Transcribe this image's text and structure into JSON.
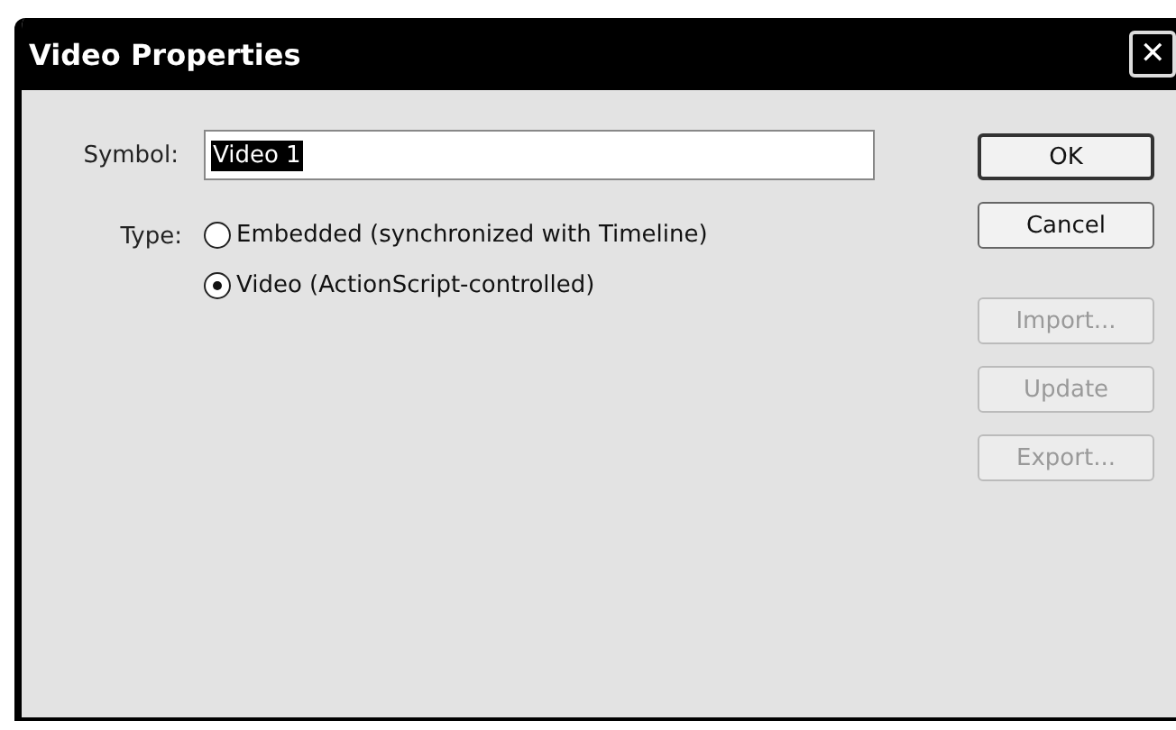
{
  "window": {
    "title": "Video Properties",
    "close": "✕"
  },
  "symbol": {
    "label": "Symbol:",
    "value": "Video 1",
    "value_selected": true
  },
  "type": {
    "label": "Type:",
    "options": [
      {
        "label": "Embedded (synchronized with Timeline)",
        "selected": false
      },
      {
        "label": "Video (ActionScript-controlled)",
        "selected": true
      }
    ]
  },
  "buttons": [
    {
      "label": "OK",
      "default": true,
      "disabled": false
    },
    {
      "label": "Cancel",
      "default": false,
      "disabled": false
    },
    {
      "label": "Import...",
      "default": false,
      "disabled": true
    },
    {
      "label": "Update",
      "default": false,
      "disabled": true
    },
    {
      "label": "Export...",
      "default": false,
      "disabled": true
    }
  ]
}
